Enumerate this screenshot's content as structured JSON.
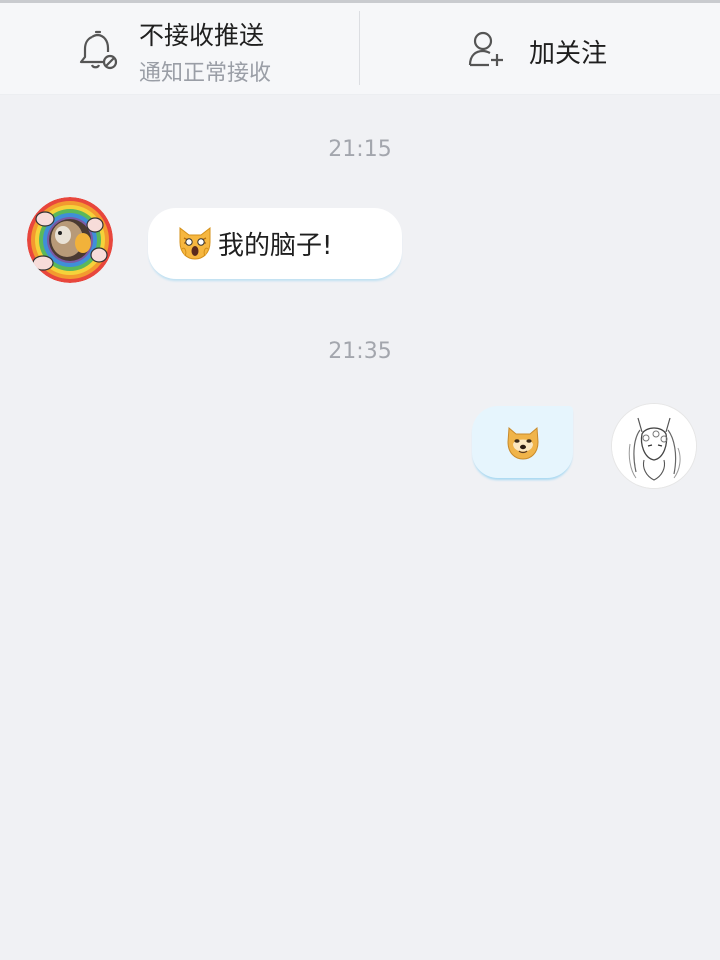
{
  "action_bar": {
    "push_title": "不接收推送",
    "push_subtitle": "通知正常接收",
    "follow_label": "加关注"
  },
  "messages": [
    {
      "timestamp": "21:15",
      "sender": "other",
      "text": "我的脑子!",
      "emoji": "scream-cat-icon"
    },
    {
      "timestamp": "21:35",
      "sender": "self",
      "emoji": "doge-icon"
    }
  ],
  "colors": {
    "background": "#f0f1f4",
    "bubble_other": "#ffffff",
    "bubble_self": "#e6f5fd",
    "timestamp": "#a3a6ad",
    "subtitle": "#9a9ea6"
  }
}
